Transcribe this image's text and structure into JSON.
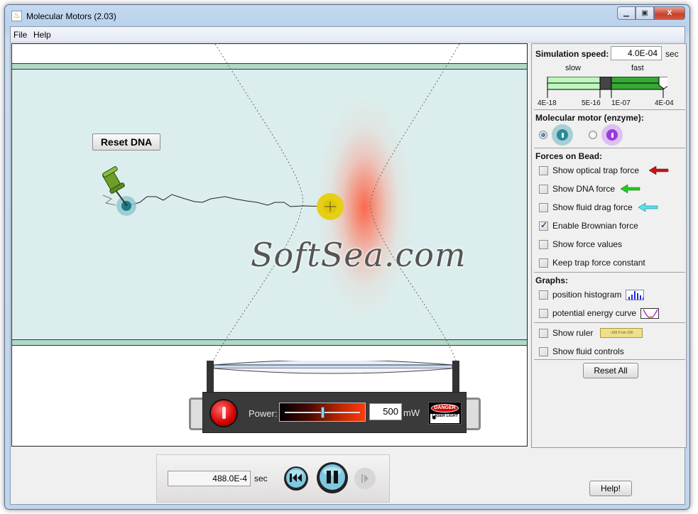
{
  "window": {
    "title": "Molecular Motors (2.03)",
    "controls": {
      "minimize": "_",
      "maximize": "□",
      "close": "X"
    }
  },
  "menu": [
    "File",
    "Help"
  ],
  "play_area": {
    "reset_dna_label": "Reset DNA",
    "watermark": "SoftSea.com",
    "laser": {
      "power_label": "Power:",
      "power_value": "500",
      "power_unit": "mW",
      "power_fraction": 0.5,
      "danger_text": "DANGER",
      "danger_sub": "LASER LIGHT"
    }
  },
  "controls": {
    "sim_speed_label": "Simulation speed:",
    "sim_speed_value": "4.0E-04",
    "sim_speed_unit": "sec",
    "slow_label": "slow",
    "fast_label": "fast",
    "speed_ticks": [
      "4E-18",
      "5E-16",
      "1E-07",
      "4E-04"
    ],
    "motor_heading": "Molecular motor (enzyme):",
    "motors": [
      {
        "name": "teal-motor",
        "selected": true,
        "color": "#2a8a9a"
      },
      {
        "name": "purple-motor",
        "selected": false,
        "color": "#9a3ad8"
      }
    ],
    "forces_heading": "Forces on Bead:",
    "forces": [
      {
        "label": "Show optical trap force",
        "checked": false,
        "arrow_color": "#c81414"
      },
      {
        "label": "Show DNA force",
        "checked": false,
        "arrow_color": "#22cc22"
      },
      {
        "label": "Show fluid drag force",
        "checked": false,
        "arrow_color": "#55e0f0"
      },
      {
        "label": "Enable Brownian force",
        "checked": true
      },
      {
        "label": "Show force values",
        "checked": false
      },
      {
        "label": "Keep trap force constant",
        "checked": false
      }
    ],
    "graphs_heading": "Graphs:",
    "graphs": [
      {
        "label": "position histogram",
        "checked": false
      },
      {
        "label": "potential energy curve",
        "checked": false
      }
    ],
    "misc": [
      {
        "label": "Show ruler",
        "checked": false,
        "ruler_text": "-100    0 nm  100"
      },
      {
        "label": "Show fluid controls",
        "checked": false
      }
    ],
    "reset_all_label": "Reset All"
  },
  "clock": {
    "time_value": "488.0E-4",
    "time_unit": "sec"
  },
  "help_label": "Help!"
}
